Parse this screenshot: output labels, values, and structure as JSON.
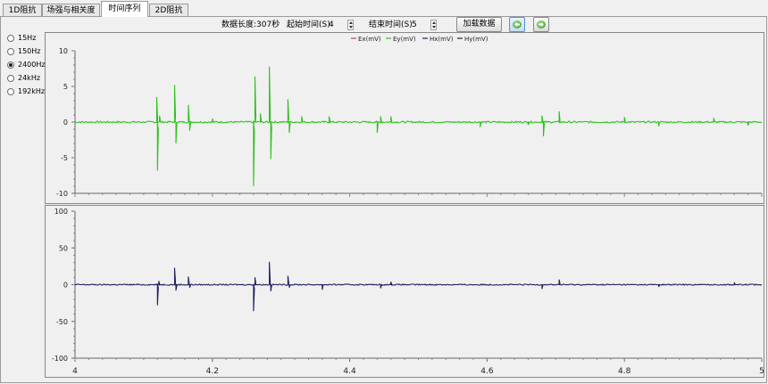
{
  "tabs": [
    {
      "label": "1D阻抗",
      "active": false
    },
    {
      "label": "场强与相关度",
      "active": false
    },
    {
      "label": "时间序列",
      "active": true
    },
    {
      "label": "2D阻抗",
      "active": false
    }
  ],
  "toolbar": {
    "data_length": "数据长度:307秒",
    "start_label": "起始时间(S)",
    "start_value": "4",
    "end_label": "结束时间(S)",
    "end_value": "5",
    "load_button": "加载数据",
    "prev_icon": "arrow-left-icon",
    "next_icon": "arrow-right-icon"
  },
  "frequencies": [
    {
      "label": "15Hz",
      "selected": false
    },
    {
      "label": "150Hz",
      "selected": false
    },
    {
      "label": "2400Hz",
      "selected": true
    },
    {
      "label": "24kHz",
      "selected": false
    },
    {
      "label": "192kHz",
      "selected": false
    }
  ],
  "chart_data": [
    {
      "type": "line",
      "ylim": [
        -10,
        10
      ],
      "yticks": [
        "10",
        "5",
        "0",
        "-5",
        "-10"
      ],
      "xlim": [
        4,
        5
      ],
      "legend": [
        {
          "name": "Ex(mV)",
          "color": "#d04040"
        },
        {
          "name": "Ey(mV)",
          "color": "#30c020"
        },
        {
          "name": "Hx(mV)",
          "color": "#202060"
        },
        {
          "name": "Hy(mV)",
          "color": "#202020"
        }
      ],
      "legend_placement": "top-center",
      "series": [
        {
          "name": "Ey(mV)",
          "color": "#30c020",
          "spikes": [
            [
              4.119,
              3.5
            ],
            [
              4.12,
              -6.8
            ],
            [
              4.123,
              0.9
            ],
            [
              4.145,
              5.2
            ],
            [
              4.147,
              -3
            ],
            [
              4.165,
              2.4
            ],
            [
              4.167,
              -1.2
            ],
            [
              4.2,
              0.5
            ],
            [
              4.26,
              -9
            ],
            [
              4.262,
              6.4
            ],
            [
              4.27,
              1.2
            ],
            [
              4.283,
              7.8
            ],
            [
              4.285,
              -5.2
            ],
            [
              4.31,
              3.2
            ],
            [
              4.312,
              -1.5
            ],
            [
              4.33,
              0.8
            ],
            [
              4.37,
              0.8
            ],
            [
              4.44,
              -1.5
            ],
            [
              4.445,
              0.8
            ],
            [
              4.46,
              0.8
            ],
            [
              4.59,
              -0.7
            ],
            [
              4.66,
              -0.4
            ],
            [
              4.68,
              0.9
            ],
            [
              4.682,
              -2
            ],
            [
              4.705,
              1.5
            ],
            [
              4.8,
              0.7
            ],
            [
              4.85,
              -0.6
            ],
            [
              4.93,
              0.6
            ],
            [
              4.98,
              -0.5
            ]
          ]
        }
      ]
    },
    {
      "type": "line",
      "ylim": [
        -100,
        100
      ],
      "yticks": [
        "100",
        "50",
        "0",
        "-50",
        "-100"
      ],
      "xlim": [
        4,
        5
      ],
      "xticks": [
        "4",
        "4.2",
        "4.4",
        "4.6",
        "4.8",
        "5"
      ],
      "series": [
        {
          "name": "Hx(mV)",
          "color": "#202060",
          "spikes": [
            [
              4.12,
              -28
            ],
            [
              4.122,
              5
            ],
            [
              4.145,
              23
            ],
            [
              4.147,
              -8
            ],
            [
              4.165,
              11
            ],
            [
              4.167,
              -4
            ],
            [
              4.26,
              -36
            ],
            [
              4.262,
              10
            ],
            [
              4.283,
              31
            ],
            [
              4.285,
              -9
            ],
            [
              4.31,
              12
            ],
            [
              4.312,
              -4
            ],
            [
              4.36,
              -7
            ],
            [
              4.445,
              -5
            ],
            [
              4.46,
              4
            ],
            [
              4.68,
              -6
            ],
            [
              4.705,
              7
            ],
            [
              4.85,
              -3
            ],
            [
              4.96,
              3
            ]
          ]
        }
      ]
    }
  ]
}
